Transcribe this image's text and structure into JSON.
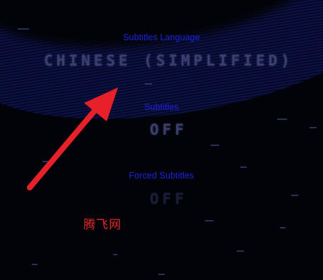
{
  "settings": [
    {
      "label": "Subtitles Language",
      "value": "CHINESE (SIMPLIFIED)"
    },
    {
      "label": "Subtitles",
      "value": "OFF"
    },
    {
      "label": "Forced Subtitles",
      "value": "OFF"
    }
  ],
  "watermark": "腾飞网",
  "colors": {
    "background": "#020308",
    "label": "#1c22e0",
    "value": "#3a3f6e",
    "arrow": "#e8202a"
  },
  "icons": {
    "annotation_arrow": "red-arrow-icon"
  }
}
